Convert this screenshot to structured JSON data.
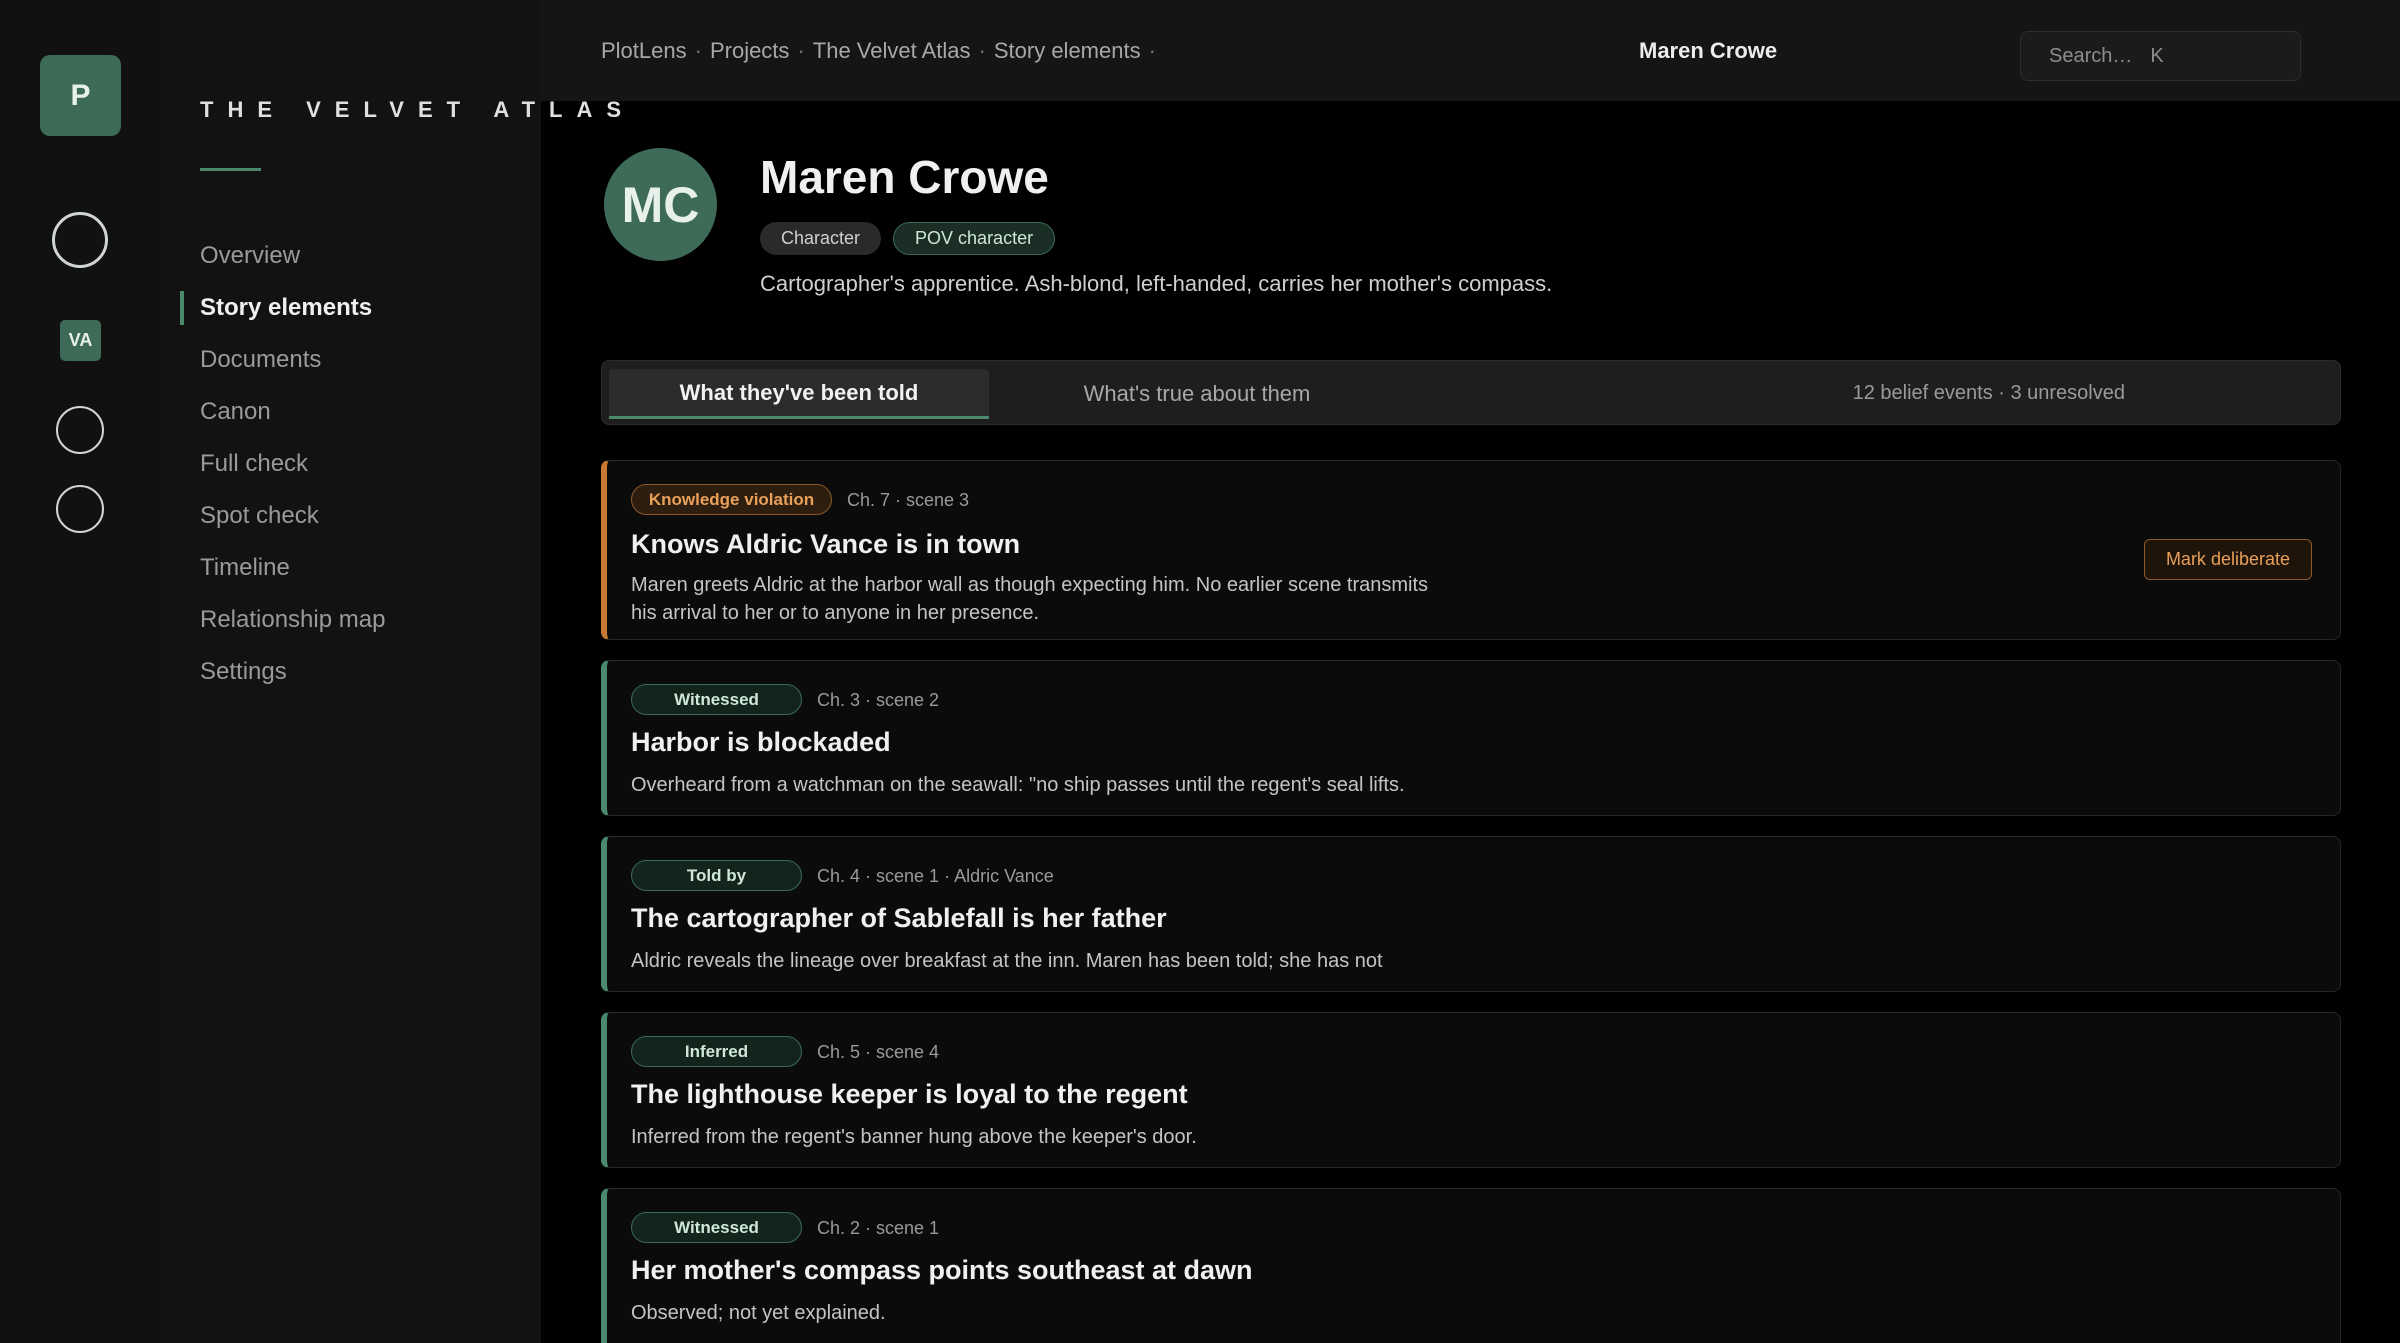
{
  "app": {
    "logo_letter": "P",
    "rail_badge": "VA"
  },
  "project_title": "THE VELVET ATLAS",
  "nav": {
    "items": [
      {
        "label": "Overview"
      },
      {
        "label": "Story elements",
        "active": true
      },
      {
        "label": "Documents"
      },
      {
        "label": "Canon"
      },
      {
        "label": "Full check"
      },
      {
        "label": "Spot check"
      },
      {
        "label": "Timeline"
      },
      {
        "label": "Relationship map"
      },
      {
        "label": "Settings"
      }
    ]
  },
  "breadcrumb": [
    "PlotLens",
    "Projects",
    "The Velvet Atlas",
    "Story elements"
  ],
  "breadcrumb_sep": "·",
  "top_user": "Maren Crowe",
  "search": {
    "placeholder": "Search…",
    "shortcut": "K"
  },
  "profile": {
    "initials": "MC",
    "name": "Maren Crowe",
    "tags": [
      "Character",
      "POV character"
    ],
    "description": "Cartographer's apprentice. Ash-blond, left-handed, carries her mother's compass."
  },
  "tabs": {
    "active": "What they've been told",
    "inactive": "What's true about them",
    "stats": "12 belief events  ·  3 unresolved"
  },
  "cards": [
    {
      "badge": "Knowledge violation",
      "meta": "Ch. 7 · scene 3",
      "title": "Knows Aldric Vance is in town",
      "body": "Maren greets Aldric at the harbor wall as though expecting him. No earlier scene transmits his arrival to her or to anyone in her presence.",
      "action": "Mark deliberate"
    },
    {
      "badge": "Witnessed",
      "meta": "Ch. 3 · scene 2",
      "title": "Harbor is blockaded",
      "body": "Overheard from a watchman on the seawall: \"no ship passes until the regent's seal lifts."
    },
    {
      "badge": "Told by",
      "meta": "Ch. 4 · scene 1 · Aldric Vance",
      "title": "The cartographer of Sablefall is her father",
      "body": "Aldric reveals the lineage over breakfast at the inn. Maren has been told; she has not"
    },
    {
      "badge": "Inferred",
      "meta": "Ch. 5 · scene 4",
      "title": "The lighthouse keeper is loyal to the regent",
      "body": "Inferred from the regent's banner hung above the keeper's door."
    },
    {
      "badge": "Witnessed",
      "meta": "Ch. 2 · scene 1",
      "title": "Her mother's compass points southeast at dawn",
      "body": "Observed; not yet explained."
    }
  ],
  "colors": {
    "accent_green": "#4c8a6e",
    "violation_orange": "#c87a35"
  }
}
